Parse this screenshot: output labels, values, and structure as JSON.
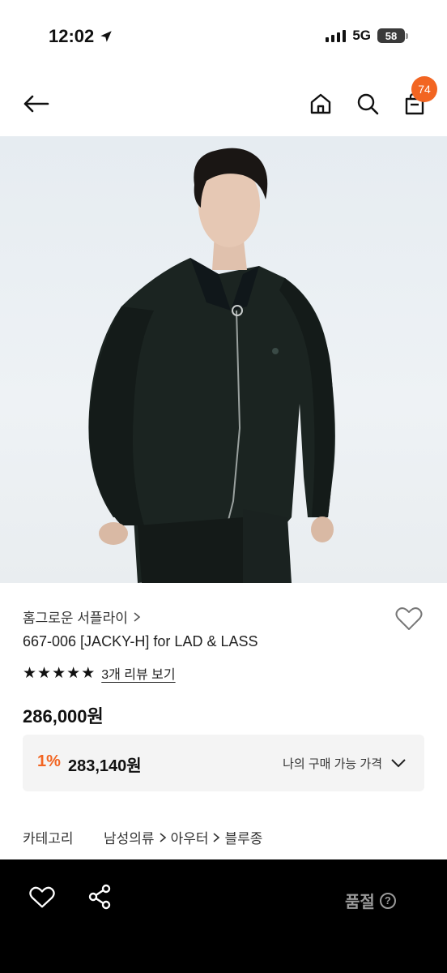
{
  "status_bar": {
    "time": "12:02",
    "network": "5G",
    "battery": "58"
  },
  "header": {
    "cart_count": "74"
  },
  "product": {
    "brand": "홈그로운 서플라이",
    "name": "667-006 [JACKY-H] for LAD & LASS",
    "rating_stars": 5,
    "review_link": "3개 리뷰 보기",
    "price": "286,000원",
    "discount": {
      "rate": "1%",
      "price": "283,140원",
      "label": "나의 구매 가능 가격"
    },
    "category": {
      "label": "카테고리",
      "path": [
        "남성의류",
        "아우터",
        "블루종"
      ]
    }
  },
  "bottom_bar": {
    "soldout_label": "품절"
  }
}
